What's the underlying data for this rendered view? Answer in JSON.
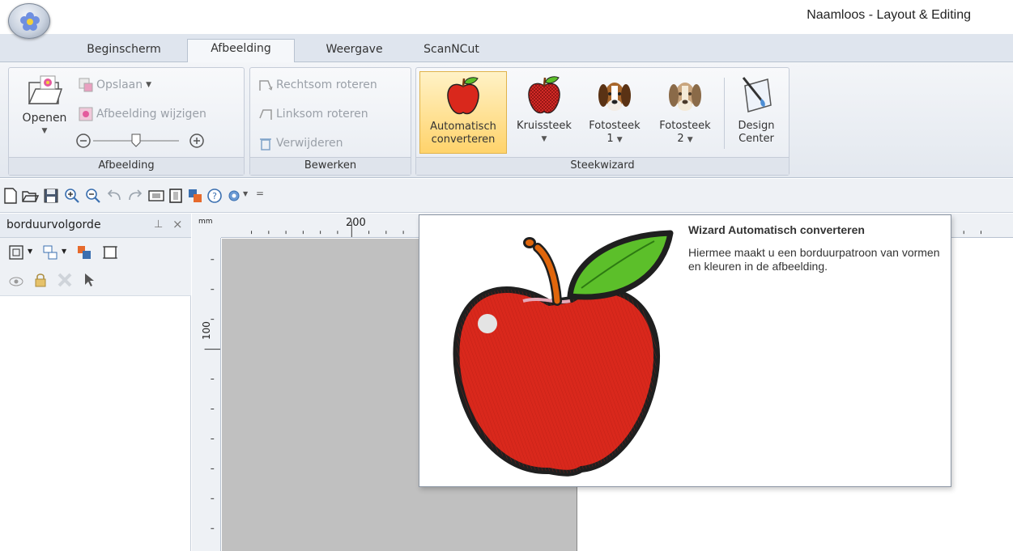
{
  "window": {
    "title": "Naamloos - Layout & Editing"
  },
  "tabs": [
    {
      "label": "Beginscherm",
      "active": false
    },
    {
      "label": "Afbeelding",
      "active": true
    },
    {
      "label": "Weergave",
      "active": false
    },
    {
      "label": "ScanNCut",
      "active": false
    }
  ],
  "ribbon": {
    "afbeelding": {
      "label": "Afbeelding",
      "open_label": "Openen",
      "save_label": "Opslaan",
      "modify_label": "Afbeelding wijzigen"
    },
    "bewerken": {
      "label": "Bewerken",
      "rotate_right": "Rechtsom roteren",
      "rotate_left": "Linksom roteren",
      "delete": "Verwijderen"
    },
    "steekwizard": {
      "label": "Steekwizard",
      "auto_line1": "Automatisch",
      "auto_line2": "converteren",
      "cross": "Kruissteek",
      "photo1_line1": "Fotosteek",
      "photo1_line2": "1",
      "photo2_line1": "Fotosteek",
      "photo2_line2": "2",
      "design_line1": "Design",
      "design_line2": "Center"
    }
  },
  "pane": {
    "title": "borduurvolgorde"
  },
  "ruler": {
    "unit": "mm",
    "h_label": "200",
    "v_label": "100"
  },
  "tooltip": {
    "title": "Wizard Automatisch converteren",
    "body": "Hiermee maakt u een borduurpatroon van vormen en kleuren in de afbeelding."
  },
  "colors": {
    "apple_red": "#d9281c",
    "leaf_green": "#5cbf2a",
    "selected_bg": "#ffd36b",
    "canvas_grey": "#c0c0c0"
  }
}
